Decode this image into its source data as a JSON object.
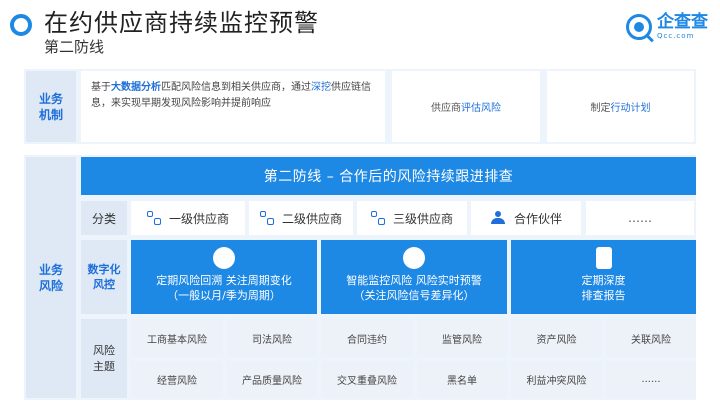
{
  "header": {
    "title": "在约供应商持续监控预警",
    "subtitle": "第二防线"
  },
  "logo": {
    "name": "企查查",
    "sub": "Qcc.com"
  },
  "business_mechanism": {
    "label_line1": "业务",
    "label_line2": "机制",
    "desc": {
      "p1": "基于",
      "p2": "大数据分析",
      "p3": "匹配风险信息到相关供应商，通过",
      "p4": "深挖",
      "p5": "供应链信息，来实现早期发现风险影响并提前响应"
    },
    "box2": {
      "p1": "供应商",
      "p2": "评估风险"
    },
    "box3": {
      "p1": "制定",
      "p2": "行动计划"
    }
  },
  "business_risk": {
    "label_line1": "业务",
    "label_line2": "风险",
    "banner": "第二防线 – 合作后的风险持续跟进排查",
    "category": {
      "label": "分类",
      "items": [
        "一级供应商",
        "二级供应商",
        "三级供应商",
        "合作伙伴",
        "……"
      ]
    },
    "digital": {
      "label_line1": "数字化",
      "label_line2": "风控",
      "cells": [
        {
          "line1": "定期风险回溯  关注周期变化",
          "line2": "（一般以月/季为周期）"
        },
        {
          "line1": "智能监控风险  风险实时预警",
          "line2": "（关注风险信号差异化）"
        },
        {
          "line1": "定期深度",
          "line2": "排查报告"
        }
      ]
    },
    "topics": {
      "label_line1": "风险",
      "label_line2": "主题",
      "row1": [
        "工商基本风险",
        "司法风险",
        "合同违约",
        "监管风险",
        "资产风险",
        "关联风险"
      ],
      "row2": [
        "经营风险",
        "产品质量风险",
        "交叉重叠风险",
        "黑名单",
        "利益冲突风险",
        "......"
      ]
    }
  },
  "colors": {
    "primary": "#1e88e5",
    "label_bg": "#dfe9f5",
    "panel_bg": "#eef4fb"
  }
}
